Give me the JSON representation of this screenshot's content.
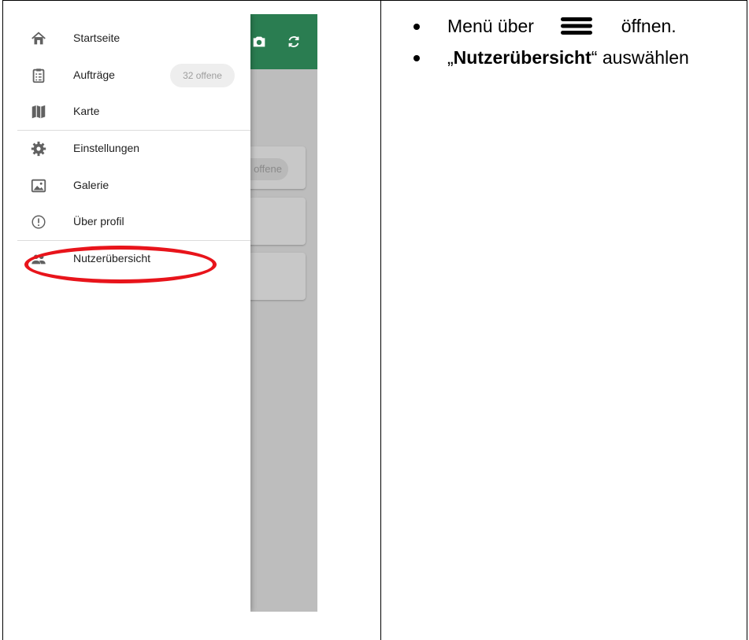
{
  "drawer": {
    "items": [
      {
        "label": "Startseite",
        "icon": "home-icon"
      },
      {
        "label": "Aufträge",
        "icon": "clipboard-list-icon",
        "badge": "32 offene"
      },
      {
        "label": "Karte",
        "icon": "map-icon"
      },
      {
        "label": "Einstellungen",
        "icon": "gear-icon"
      },
      {
        "label": "Galerie",
        "icon": "gallery-icon"
      },
      {
        "label": "Über profil",
        "icon": "info-icon"
      },
      {
        "label": "Nutzerübersicht",
        "icon": "people-icon"
      }
    ]
  },
  "background": {
    "chip_text": "offene"
  },
  "instructions": {
    "line1_before": "Menü über",
    "line1_after": "öffnen.",
    "line2_open_quote": "„",
    "line2_bold": "Nutzerübersicht",
    "line2_rest": "“ auswählen"
  },
  "colors": {
    "app_bar": "#2a7d51",
    "highlight": "#e8141b",
    "scrim": "#bdbdbd"
  }
}
